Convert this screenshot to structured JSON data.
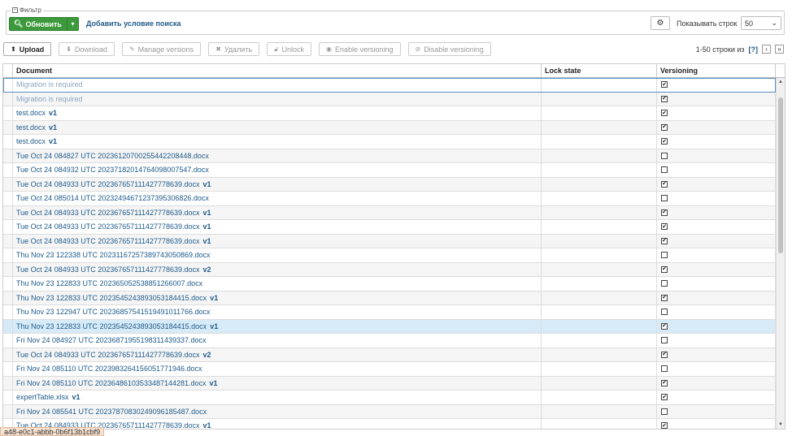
{
  "filter": {
    "legend": "Фильтр",
    "refresh_label": "Обновить",
    "add_condition": "Добавить условие поиска",
    "rows_label": "Показывать строк",
    "rows_value": "50"
  },
  "toolbar": {
    "upload": "Upload",
    "download": "Download",
    "manage_versions": "Manage versions",
    "delete": "Удалить",
    "unlock": "Unlock",
    "enable_versioning": "Enable versioning",
    "disable_versioning": "Disable versioning"
  },
  "pager": {
    "range": "1-50 строки из",
    "help": "[?]",
    "next": "›",
    "last": "»"
  },
  "grid": {
    "columns": [
      "Document",
      "Lock state",
      "Versioning"
    ],
    "rows": [
      {
        "name": "Migration is required",
        "ver": "",
        "checked": true,
        "muted": true
      },
      {
        "name": "Migration is required",
        "ver": "",
        "checked": true,
        "muted": true
      },
      {
        "name": "test.docx",
        "ver": "v1",
        "checked": true
      },
      {
        "name": "test.docx",
        "ver": "v1",
        "checked": true
      },
      {
        "name": "test.docx",
        "ver": "v1",
        "checked": true
      },
      {
        "name": "Tue Oct 24 084827 UTC 20236120700255442208448.docx",
        "ver": "",
        "checked": false
      },
      {
        "name": "Tue Oct 24 084932 UTC 20237182014764098007547.docx",
        "ver": "",
        "checked": false
      },
      {
        "name": "Tue Oct 24 084933 UTC 20236765711142777863​9.docx",
        "ver": "v1",
        "checked": true
      },
      {
        "name": "Tue Oct 24 085014 UTC 20232494671237395306826.docx",
        "ver": "",
        "checked": false
      },
      {
        "name": "Tue Oct 24 084933 UTC 20236765711142777863​9.docx",
        "ver": "v1",
        "checked": true
      },
      {
        "name": "Tue Oct 24 084933 UTC 20236765711142777863​9.docx",
        "ver": "v1",
        "checked": true
      },
      {
        "name": "Tue Oct 24 084933 UTC 20236765711142777863​9.docx",
        "ver": "v1",
        "checked": true
      },
      {
        "name": "Thu Nov 23 122338 UTC 20231167257389743050869.docx",
        "ver": "",
        "checked": false
      },
      {
        "name": "Tue Oct 24 084933 UTC 20236765711142777863​9.docx",
        "ver": "v2",
        "checked": true
      },
      {
        "name": "Thu Nov 23 122833 UTC 20236505253885126600​7.docx",
        "ver": "",
        "checked": false
      },
      {
        "name": "Thu Nov 23 122833 UTC 20235452438930531844​15.docx",
        "ver": "v1",
        "checked": true
      },
      {
        "name": "Thu Nov 23 122947 UTC 20236857541519491011766.docx",
        "ver": "",
        "checked": false
      },
      {
        "name": "Thu Nov 23 122833 UTC 20235452438930531844​15.docx",
        "ver": "v1",
        "checked": true,
        "selected": true
      },
      {
        "name": "Fri Nov 24 084927 UTC 20236871955198311439337.docx",
        "ver": "",
        "checked": false
      },
      {
        "name": "Tue Oct 24 084933 UTC 20236765711142777863​9.docx",
        "ver": "v2",
        "checked": true
      },
      {
        "name": "Fri Nov 24 085110 UTC 20239832641560517719​46.docx",
        "ver": "",
        "checked": false
      },
      {
        "name": "Fri Nov 24 085110 UTC 20236486103533487144281.docx",
        "ver": "v1",
        "checked": true
      },
      {
        "name": "expertTable.xlsx",
        "ver": "v1",
        "checked": true
      },
      {
        "name": "Fri Nov 24 085541 UTC 20237870830249096185487.docx",
        "ver": "",
        "checked": false
      },
      {
        "name": "Tue Oct 24 084933 UTC 20236765711142777863​9.docx",
        "ver": "v1",
        "checked": true
      }
    ]
  },
  "status_chip": "a48-e0c1-abbb-0b6f13b1cbf9",
  "icons": {
    "search": "search-icon",
    "caret": "chevron-down-icon",
    "gear": "gear-icon",
    "upload": "upload-icon",
    "download": "download-icon",
    "pencil": "pencil-icon",
    "times": "close-icon",
    "unlock": "unlock-icon",
    "eye": "eye-icon",
    "eye_slash": "eye-slash-icon"
  },
  "colors": {
    "accent": "#3c9a3c",
    "link": "#1e5a8a",
    "selected_row": "#d6eaf7"
  }
}
